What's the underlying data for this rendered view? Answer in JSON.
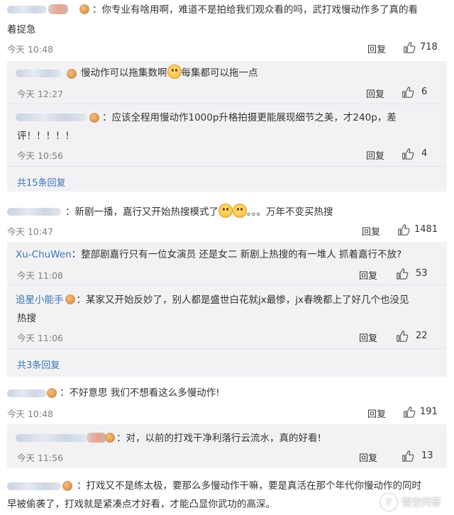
{
  "comments": [
    {
      "text_line1": "：你专业有啥用啊，难道不是拍给我们观众看的吗，武打戏慢动作多了真的看",
      "text_line2": "着捉急",
      "time": "今天 10:48",
      "reply_label": "回复",
      "likes": "718",
      "sub_replies": [
        {
          "text_line1": "慢动作可以拖集数啊",
          "text_after_emoji": "每集都可以拖一点",
          "time": "今天 12:27",
          "reply_label": "回复",
          "likes": "6"
        },
        {
          "text_line1": "：应该全程用慢动作1000p升格拍摄更能展现细节之美，才240p，差",
          "text_line2": "评！！！！！",
          "time": "今天 10:56",
          "reply_label": "回复",
          "likes": "4"
        }
      ],
      "more_replies": "共15条回复"
    },
    {
      "text_pre": "：新剧一播，嘉行又开始热搜模式了",
      "text_post": "。。。万年不变买热搜",
      "time": "今天 10:47",
      "reply_label": "回复",
      "likes": "1481",
      "sub_replies": [
        {
          "name": "Xu-ChuWen",
          "text_line1": "：整部剧嘉行只有一位女演员 还是女二 新剧上热搜的有一堆人 抓着嘉行不放?",
          "time": "今天 11:08",
          "reply_label": "回复",
          "likes": "53"
        },
        {
          "name": "追星小能手",
          "text_line1": "：某家又开始反妙了，别人都是盛世白花就jx最惨，jx春晚都上了好几个也没见",
          "text_line2": "热搜",
          "time": "今天 11:06",
          "reply_label": "回复",
          "likes": "22"
        }
      ],
      "more_replies": "共3条回复"
    },
    {
      "text_line1": "：不好意思 我们不想看这么多慢动作!",
      "time": "今天 10:48",
      "reply_label": "回复",
      "likes": "191",
      "sub_replies": [
        {
          "text_line1": "：对，以前的打戏干净利落行云流水，真的好看!",
          "time": "今天 11:56",
          "reply_label": "回复",
          "likes": "13"
        }
      ]
    },
    {
      "text_line1": "：打戏又不是练太极，要那么多慢动作干嘛，要是真活在那个年代你慢动作的同时",
      "text_line2": "早被偷袭了，打戏就是紧凑点才好看，才能凸显你武功的高深。"
    }
  ],
  "watermark": {
    "icon": "question-answer-icon",
    "icon_glyph": "?",
    "label": "悟空问答"
  },
  "colors": {
    "link": "#3b76b6",
    "meta": "#808080",
    "panel": "#f2f2f5"
  }
}
